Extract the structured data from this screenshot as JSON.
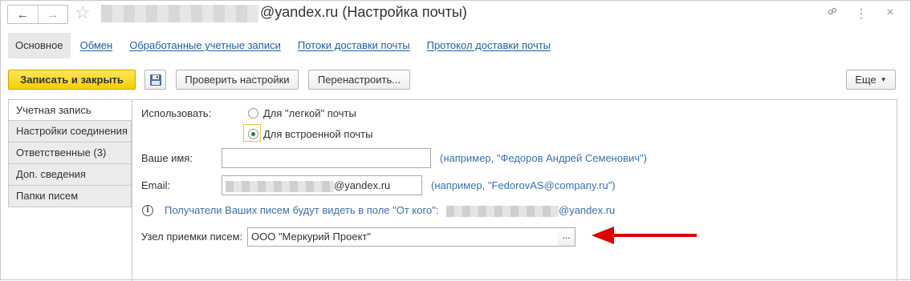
{
  "window": {
    "title_suffix": "@yandex.ru (Настройка почты)",
    "back_icon": "arrow-left-icon",
    "forward_icon": "arrow-right-icon",
    "favorite_icon": "star-icon",
    "title_icons": [
      "link-icon",
      "more-vertical-icon",
      "close-icon"
    ]
  },
  "tabs": [
    {
      "label": "Основное",
      "active": true
    },
    {
      "label": "Обмен"
    },
    {
      "label": "Обработанные учетные записи"
    },
    {
      "label": "Потоки доставки почты"
    },
    {
      "label": "Протокол доставки почты"
    }
  ],
  "toolbar": {
    "save_close_label": "Записать и закрыть",
    "save_icon": "floppy-disk-icon",
    "check_label": "Проверить настройки",
    "reconfigure_label": "Перенастроить...",
    "more_label": "Еще"
  },
  "sidebar": {
    "items": [
      {
        "label": "Учетная запись",
        "active": true
      },
      {
        "label": "Настройки соединения"
      },
      {
        "label": "Ответственные (3)"
      },
      {
        "label": "Доп. сведения"
      },
      {
        "label": "Папки писем"
      }
    ]
  },
  "form": {
    "use_label": "Использовать:",
    "radio_light": "Для \"легкой\" почты",
    "radio_builtin": "Для встроенной почты",
    "radio_selected": "Для встроенной почты",
    "name_label": "Ваше имя:",
    "name_value": "",
    "name_hint": "(например, \"Федоров Андрей Семенович\")",
    "email_label": "Email:",
    "email_visible_suffix": "@yandex.ru",
    "email_hint": "(например, \"FedorovAS@company.ru\")",
    "info_text": "Получатели Ваших писем будут видеть в поле \"От кого\":",
    "info_suffix": "@yandex.ru",
    "node_label": "Узел приемки писем:",
    "node_value": "ООО \"Меркурий Проект\"",
    "node_select_label": "...",
    "arrow_color": "#e00000"
  }
}
